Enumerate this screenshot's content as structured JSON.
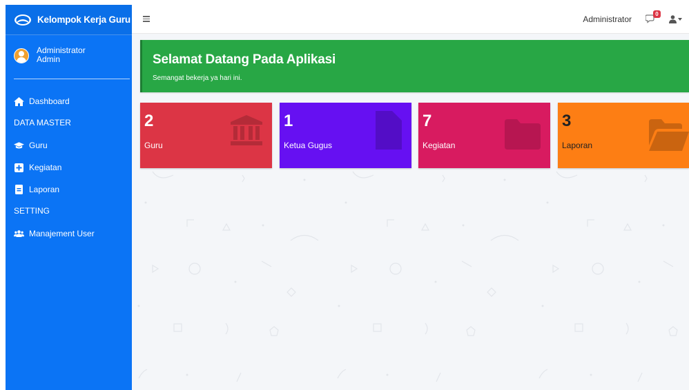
{
  "sidebar": {
    "brand": "Kelompok Kerja Guru",
    "user_name": "Administrator",
    "user_role": "Admin",
    "items": [
      {
        "label": "Dashboard",
        "icon": "home-icon"
      },
      {
        "label": "DATA MASTER",
        "type": "header"
      },
      {
        "label": "Guru",
        "icon": "graduation-cap-icon"
      },
      {
        "label": "Kegiatan",
        "icon": "plus-square-icon"
      },
      {
        "label": "Laporan",
        "icon": "file-icon"
      },
      {
        "label": "SETTING",
        "type": "header"
      },
      {
        "label": "Manajement User",
        "icon": "users-icon"
      }
    ]
  },
  "topbar": {
    "user": "Administrator",
    "notification_count": "0"
  },
  "welcome": {
    "title": "Selamat Datang Pada Aplikasi",
    "subtitle": "Semangat bekerja ya hari ini."
  },
  "cards": [
    {
      "value": "2",
      "label": "Guru",
      "color": "#dc3545",
      "icon": "university-icon"
    },
    {
      "value": "1",
      "label": "Ketua Gugus",
      "color": "#6610f2",
      "icon": "file-icon"
    },
    {
      "value": "7",
      "label": "Kegiatan",
      "color": "#d81b60",
      "icon": "folder-icon"
    },
    {
      "value": "3",
      "label": "Laporan",
      "color": "#fd7e14",
      "icon": "folder-open-icon"
    }
  ],
  "colors": {
    "sidebar": "#0b74f5",
    "welcome": "#28a745"
  }
}
